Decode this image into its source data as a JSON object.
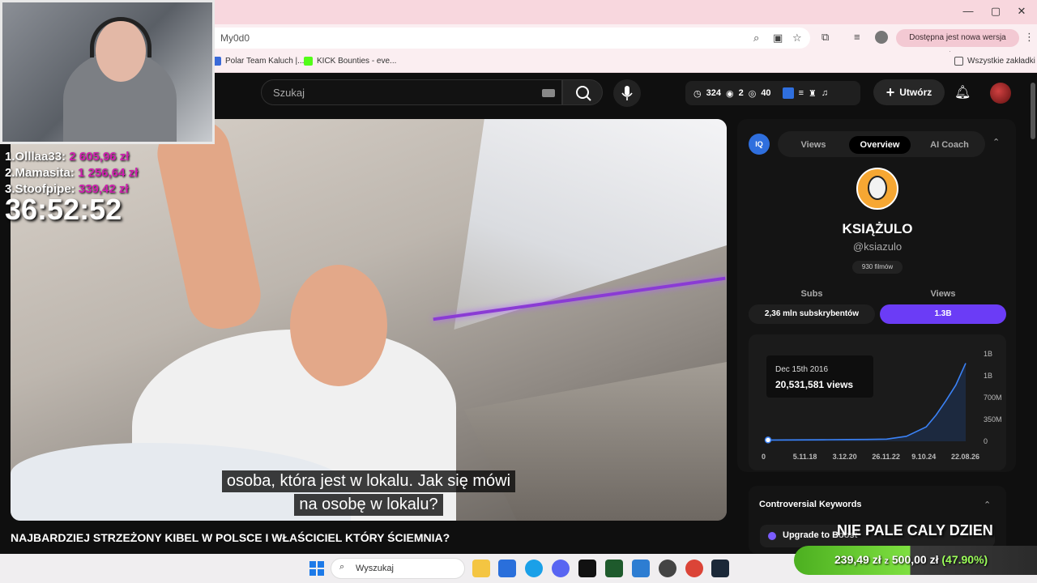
{
  "browser": {
    "url_fragment": "My0d0",
    "update_label": "Dostępna jest nowa wersja Chrome",
    "bookmarks": [
      "Polar Team Kaluch |...",
      "KICK Bounties - eve...",
      "Wszystkie zakładki"
    ]
  },
  "youtube": {
    "search_placeholder": "Szukaj",
    "stats": {
      "views_count": "324",
      "watching": "2",
      "eye": "40"
    },
    "create_label": "Utwórz"
  },
  "video": {
    "subtitle_lines": [
      "osoba, która jest w lokalu. Jak się mówi",
      "na osobę w lokalu?"
    ],
    "title": "NAJBARDZIEJ STRZEŻONY KIBEL W POLSCE I WŁAŚCICIEL KTÓRY ŚCIEMNIA?"
  },
  "stream_overlay": {
    "donors": [
      {
        "rank": "1.",
        "name": "Olllaa33:",
        "amount": "2 605,96 zł"
      },
      {
        "rank": "2.",
        "name": "Mamasita:",
        "amount": "1 256,64 zł"
      },
      {
        "rank": "3.",
        "name": "Stoofpipe:",
        "amount": "339,42 zł"
      }
    ],
    "timer": "36:52:52",
    "overlay_text": "NIE PALE CALY DZIEN",
    "goal": {
      "current": "239,49 zł",
      "sep": "z",
      "target": "500,00 zł",
      "percent": "(47.90%)",
      "progress": 0.479
    }
  },
  "panel": {
    "badge": "IQ",
    "tabs": [
      "Views",
      "Overview",
      "AI Coach"
    ],
    "active_tab": "Overview",
    "channel_name": "KSIĄŻULO",
    "channel_handle": "@ksiazulo",
    "videos_count": "930 filmów",
    "subs_label": "Subs",
    "views_label": "Views",
    "subs_value": "2,36 mln subskrybentów",
    "views_value": "1.3B",
    "keywords_title": "Controversial Keywords",
    "upgrade_label": "Upgrade to Boost"
  },
  "chart_data": {
    "type": "line",
    "x_tick_labels": [
      "0",
      "5.11.18",
      "3.12.20",
      "26.11.22",
      "9.10.24",
      "22.08.26"
    ],
    "y_tick_labels": [
      "1B",
      "1B",
      "700M",
      "350M",
      "0"
    ],
    "ylim": [
      0,
      1400000000
    ],
    "x": [
      0,
      0.5,
      1,
      1.5,
      2,
      2.5,
      3,
      3.5,
      4,
      4.25,
      4.5,
      4.75,
      5
    ],
    "values": [
      20531581,
      22000000,
      24000000,
      26000000,
      28000000,
      30000000,
      35000000,
      80000000,
      230000000,
      420000000,
      650000000,
      900000000,
      1250000000
    ],
    "tooltip": {
      "date": "Dec 15th 2016",
      "value": "20,531,581 views"
    },
    "colors": {
      "line": "#3b82f6",
      "fill": "#1f3b6d"
    }
  },
  "taskbar": {
    "search_placeholder": "Wyszukaj"
  },
  "colors": {
    "accent": "#6b3cf6",
    "iq_blue": "#2f6fde",
    "donor_amount": "#d020b0"
  }
}
